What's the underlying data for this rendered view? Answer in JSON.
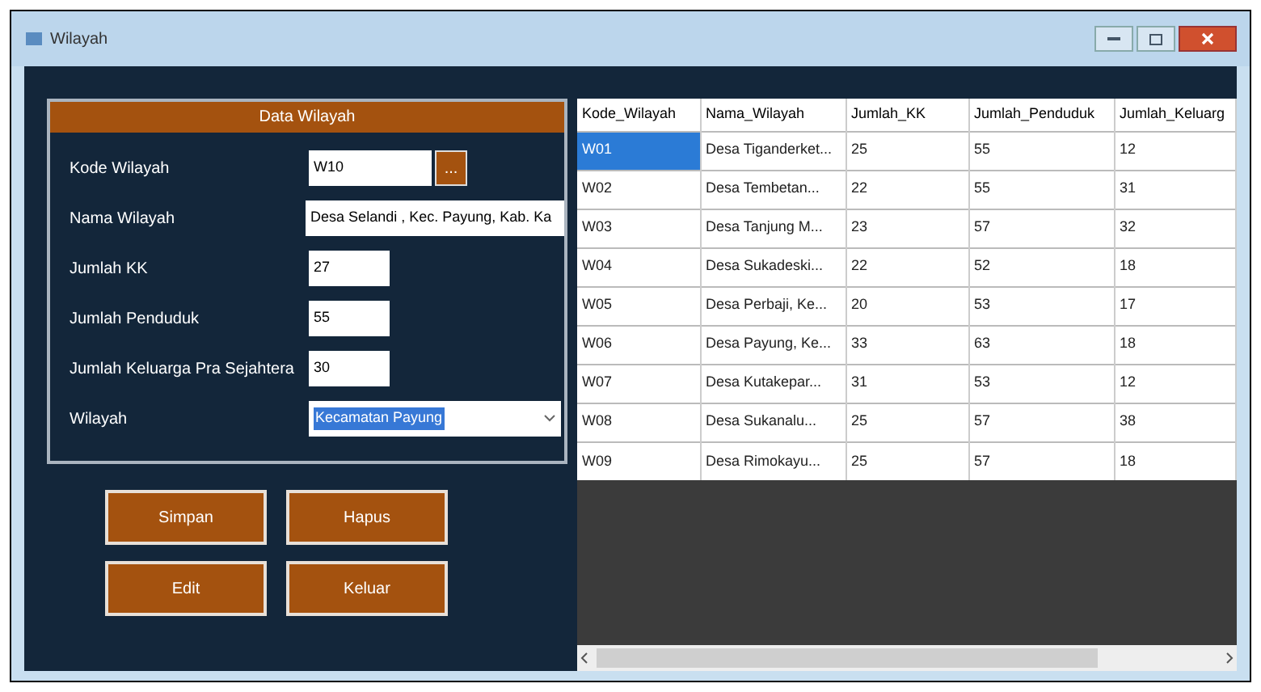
{
  "window": {
    "title": "Wilayah"
  },
  "form": {
    "title": "Data Wilayah",
    "fields": [
      {
        "kind": "lookup",
        "label": "Kode Wilayah",
        "value": "W10",
        "button": "..."
      },
      {
        "kind": "text",
        "label": "Nama Wilayah",
        "value": "Desa Selandi , Kec. Payung, Kab. Ka"
      },
      {
        "kind": "short",
        "label": "Jumlah KK",
        "value": "27"
      },
      {
        "kind": "short",
        "label": "Jumlah Penduduk",
        "value": "55"
      },
      {
        "kind": "short",
        "label": "Jumlah Keluarga Pra Sejahtera",
        "value": "30"
      },
      {
        "kind": "select",
        "label": "Wilayah",
        "value": "Kecamatan Payung"
      }
    ]
  },
  "buttons": [
    "Simpan",
    "Hapus",
    "Edit",
    "Keluar"
  ],
  "table": {
    "columns": [
      "Kode_Wilayah",
      "Nama_Wilayah",
      "Jumlah_KK",
      "Jumlah_Penduduk",
      "Jumlah_Keluarg"
    ],
    "rows": [
      {
        "selected": true,
        "cells": [
          "W01",
          "Desa Tiganderket...",
          "25",
          "55",
          "12"
        ]
      },
      {
        "selected": false,
        "cells": [
          "W02",
          "Desa Tembetan...",
          "22",
          "55",
          "31"
        ]
      },
      {
        "selected": false,
        "cells": [
          "W03",
          "Desa Tanjung M...",
          "23",
          "57",
          "32"
        ]
      },
      {
        "selected": false,
        "cells": [
          "W04",
          "Desa Sukadeski...",
          "22",
          "52",
          "18"
        ]
      },
      {
        "selected": false,
        "cells": [
          "W05",
          "Desa Perbaji, Ke...",
          "20",
          "53",
          "17"
        ]
      },
      {
        "selected": false,
        "cells": [
          "W06",
          "Desa Payung, Ke...",
          "33",
          "63",
          "18"
        ]
      },
      {
        "selected": false,
        "cells": [
          "W07",
          "Desa Kutakepar...",
          "31",
          "53",
          "12"
        ]
      },
      {
        "selected": false,
        "cells": [
          "W08",
          "Desa Sukanalu...",
          "25",
          "57",
          "38"
        ]
      },
      {
        "selected": false,
        "cells": [
          "W09",
          "Desa Rimokayu...",
          "25",
          "57",
          "18"
        ]
      }
    ]
  }
}
